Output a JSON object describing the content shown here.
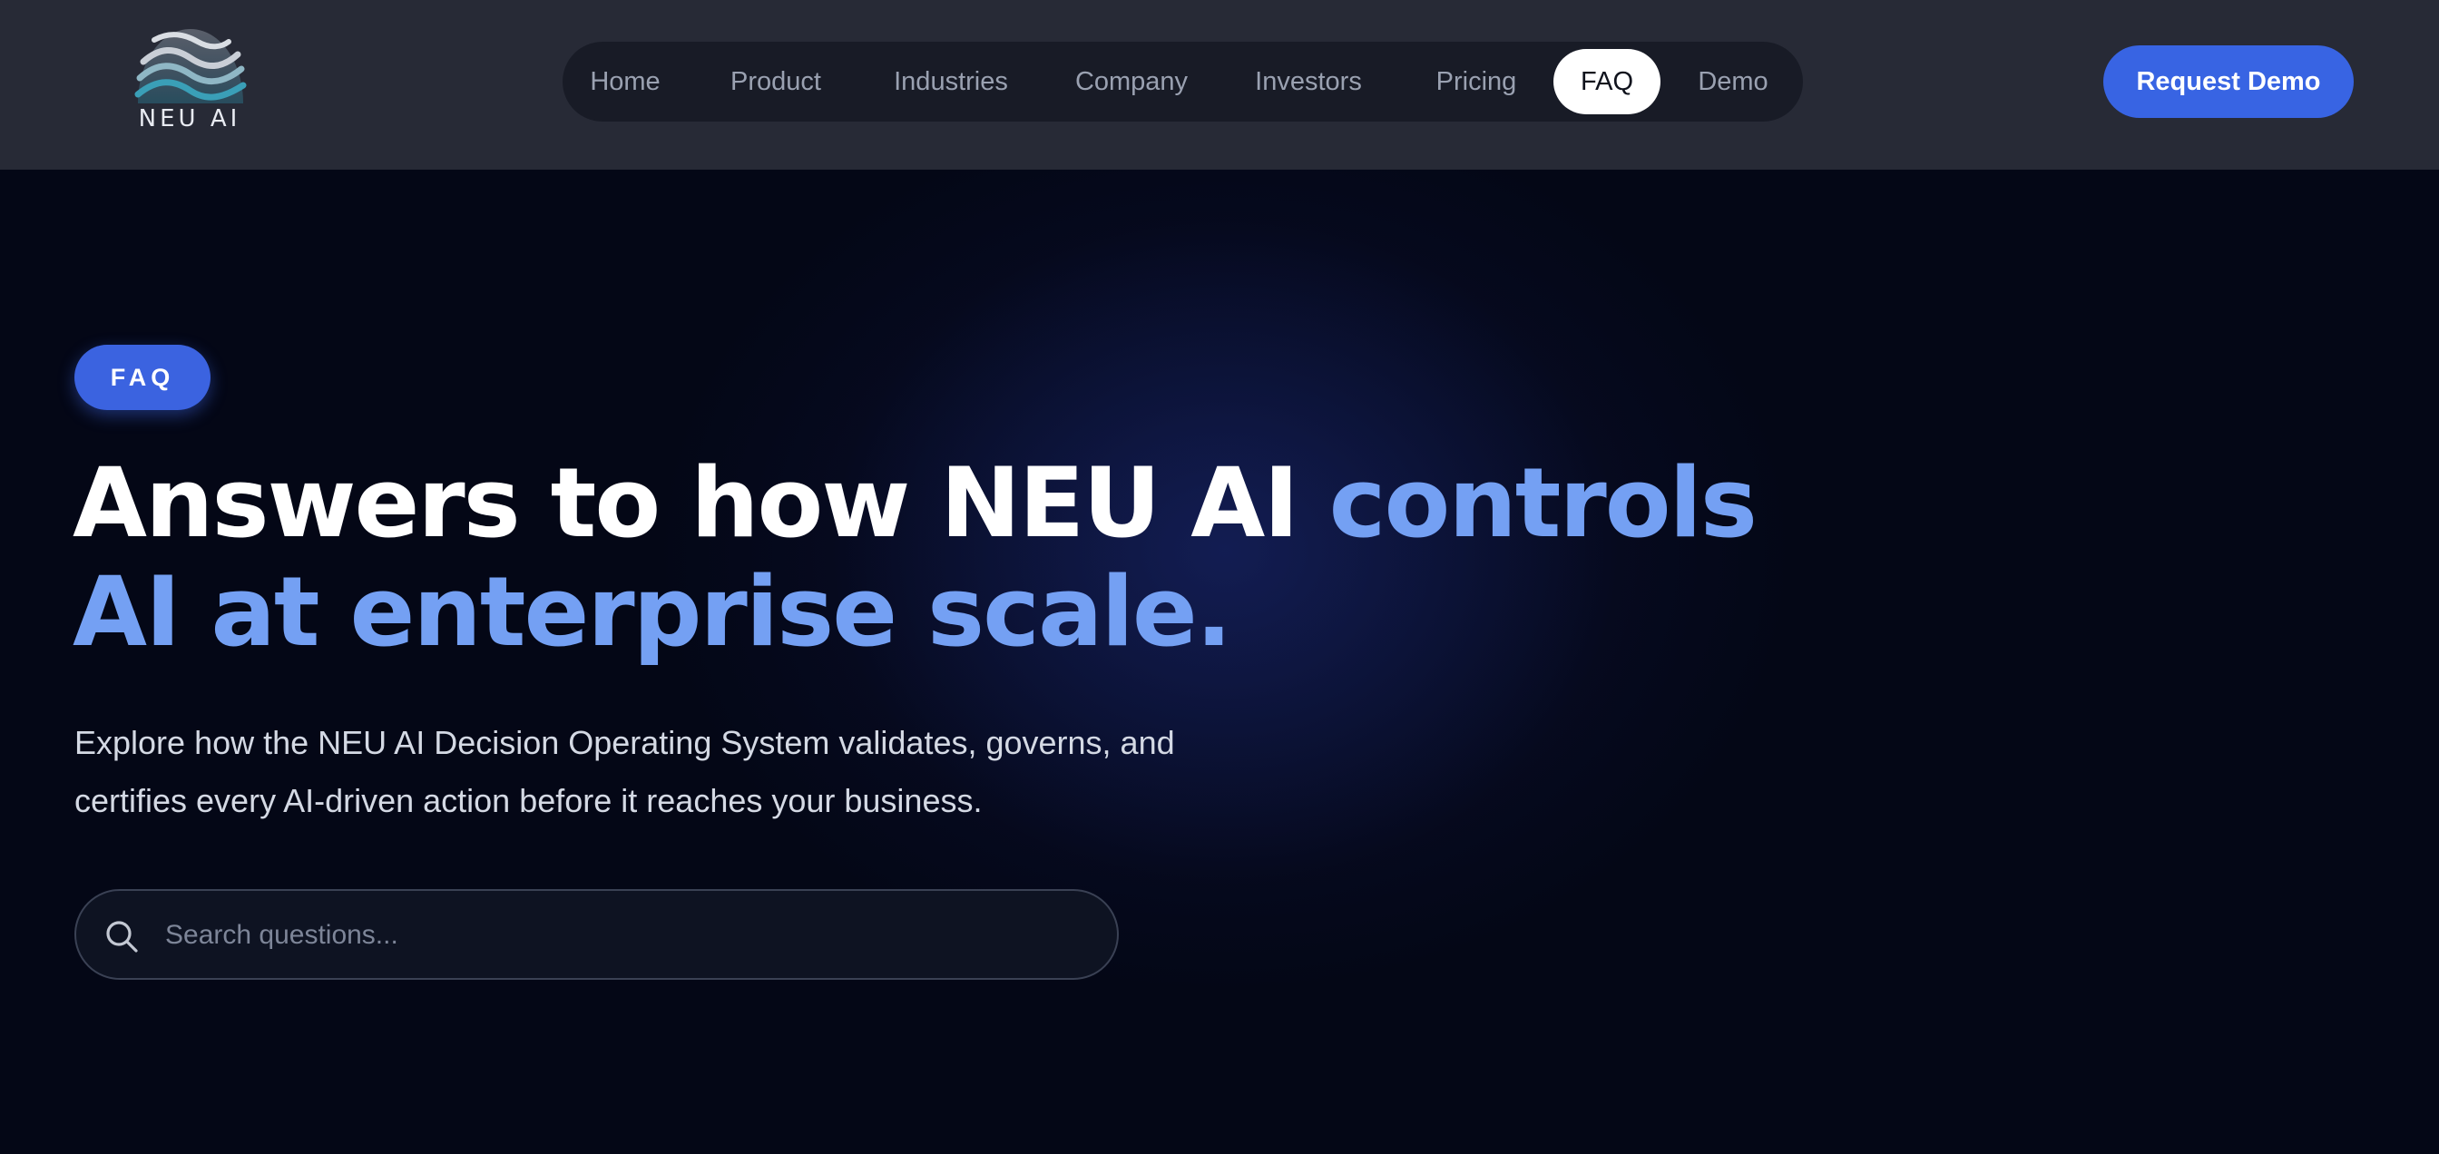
{
  "header": {
    "logo_text": "NEU AI",
    "nav": [
      {
        "label": "Home"
      },
      {
        "label": "Product"
      },
      {
        "label": "Industries"
      },
      {
        "label": "Company"
      },
      {
        "label": "Investors"
      },
      {
        "label": "Pricing"
      },
      {
        "label": "FAQ",
        "active": true
      },
      {
        "label": "Demo"
      }
    ],
    "cta_label": "Request Demo"
  },
  "hero": {
    "badge": "FAQ",
    "headline_line1_white": "Answers to how NEU AI ",
    "headline_line1_accent": "controls",
    "headline_line2_accent": "AI at enterprise scale.",
    "subtitle_line1": "Explore how the NEU AI Decision Operating System validates, governs, and",
    "subtitle_line2": "certifies every AI-driven action before it reaches your business.",
    "search": {
      "placeholder": "Search questions...",
      "value": "",
      "icon": "search-icon"
    }
  },
  "colors": {
    "header_bg": "#272a36",
    "nav_bg": "#181b26",
    "page_bg": "#040716",
    "accent": "#3864e3",
    "headline_accent": "#74a0f3"
  }
}
